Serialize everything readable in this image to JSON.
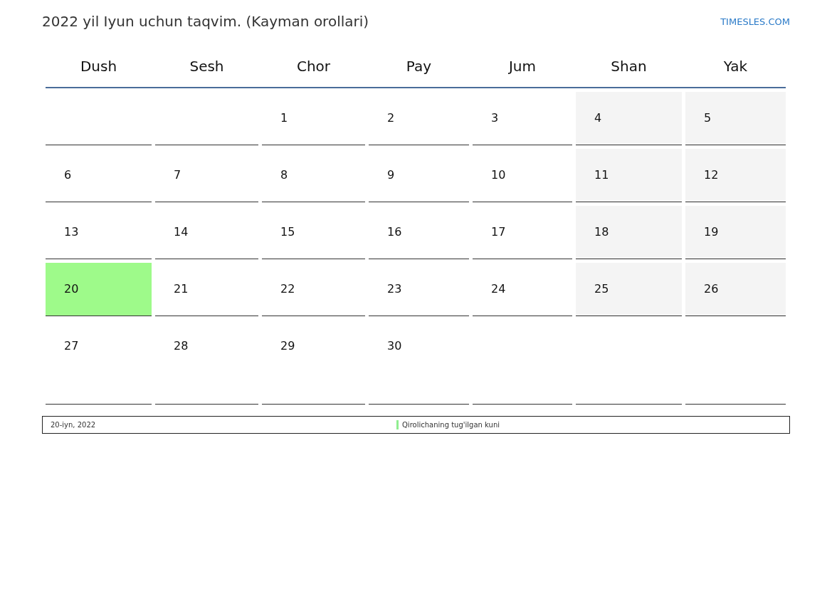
{
  "title": "2022 yil Iyun uchun taqvim. (Kayman orollari)",
  "site_link": "TIMESLES.COM",
  "weekdays": [
    "Dush",
    "Sesh",
    "Chor",
    "Pay",
    "Jum",
    "Shan",
    "Yak"
  ],
  "weeks": [
    [
      {
        "kind": "blank"
      },
      {
        "kind": "blank"
      },
      {
        "day": "1",
        "kind": "day"
      },
      {
        "day": "2",
        "kind": "day"
      },
      {
        "day": "3",
        "kind": "day"
      },
      {
        "day": "4",
        "kind": "weekend"
      },
      {
        "day": "5",
        "kind": "weekend"
      }
    ],
    [
      {
        "day": "6",
        "kind": "day"
      },
      {
        "day": "7",
        "kind": "day"
      },
      {
        "day": "8",
        "kind": "day"
      },
      {
        "day": "9",
        "kind": "day"
      },
      {
        "day": "10",
        "kind": "day"
      },
      {
        "day": "11",
        "kind": "weekend"
      },
      {
        "day": "12",
        "kind": "weekend"
      }
    ],
    [
      {
        "day": "13",
        "kind": "day"
      },
      {
        "day": "14",
        "kind": "day"
      },
      {
        "day": "15",
        "kind": "day"
      },
      {
        "day": "16",
        "kind": "day"
      },
      {
        "day": "17",
        "kind": "day"
      },
      {
        "day": "18",
        "kind": "weekend"
      },
      {
        "day": "19",
        "kind": "weekend"
      }
    ],
    [
      {
        "day": "20",
        "kind": "holiday"
      },
      {
        "day": "21",
        "kind": "day"
      },
      {
        "day": "22",
        "kind": "day"
      },
      {
        "day": "23",
        "kind": "day"
      },
      {
        "day": "24",
        "kind": "day"
      },
      {
        "day": "25",
        "kind": "weekend"
      },
      {
        "day": "26",
        "kind": "weekend"
      }
    ],
    [
      {
        "day": "27",
        "kind": "day"
      },
      {
        "day": "28",
        "kind": "day"
      },
      {
        "day": "29",
        "kind": "day"
      },
      {
        "day": "30",
        "kind": "day"
      },
      {
        "kind": "blank"
      },
      {
        "kind": "blank"
      },
      {
        "kind": "blank"
      }
    ]
  ],
  "holidays": [
    {
      "date": "20-iyn, 2022",
      "name": "Qirolichaning tug'ilgan kuni",
      "color": "#90ee90"
    }
  ]
}
